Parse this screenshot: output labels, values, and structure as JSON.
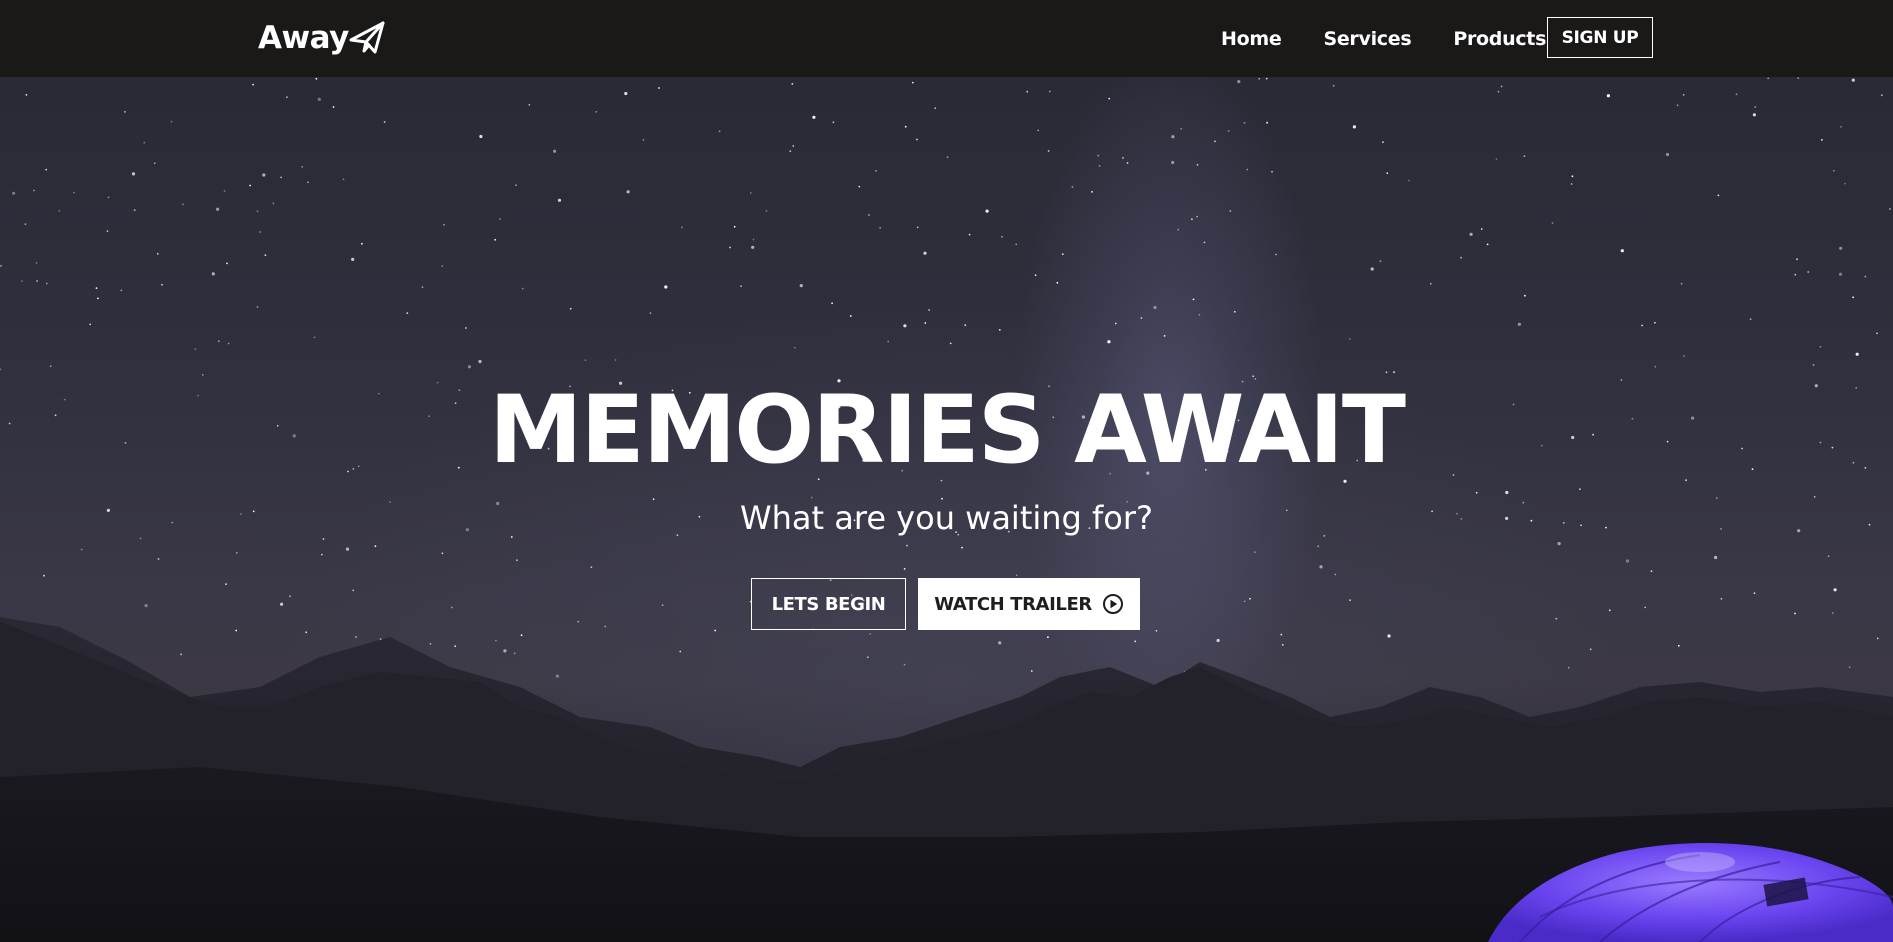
{
  "navbar": {
    "logo_text": "Away",
    "logo_icon": "paper-plane-icon",
    "links": [
      {
        "label": "Home"
      },
      {
        "label": "Services"
      },
      {
        "label": "Products"
      }
    ],
    "signup_label": "SIGN UP"
  },
  "hero": {
    "title": "MEMORIES AWAIT",
    "subtitle": "What are you waiting for?",
    "primary_button_label": "LETS BEGIN",
    "secondary_button_label": "WATCH TRAILER",
    "secondary_button_icon": "play-circle-icon",
    "background": "night-sky-mountains-tent"
  },
  "colors": {
    "navbar_bg": "#1b1818",
    "text": "#ffffff",
    "tent": "#6a45f0",
    "button_solid_bg": "#ffffff",
    "button_solid_text": "#1e1e1e"
  }
}
